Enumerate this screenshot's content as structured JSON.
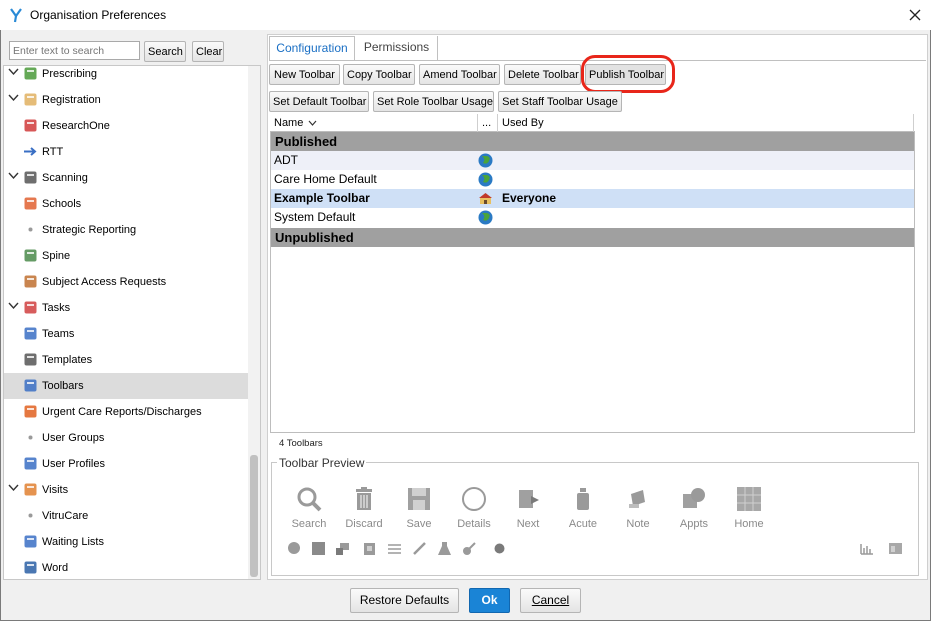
{
  "window": {
    "title": "Organisation Preferences"
  },
  "search": {
    "placeholder": "Enter text to search",
    "search_label": "Search",
    "clear_label": "Clear"
  },
  "tree": {
    "items": [
      {
        "label": "Prescribing",
        "chevron": true,
        "icon": "prescribing-icon",
        "color": "#4a9a3a"
      },
      {
        "label": "Registration",
        "chevron": true,
        "icon": "registration-folder-icon",
        "color": "#e0b060"
      },
      {
        "label": "ResearchOne",
        "chevron": false,
        "icon": "research-cube-icon",
        "color": "#d03a3a"
      },
      {
        "label": "RTT",
        "chevron": false,
        "icon": "arrow-right-icon",
        "color": "#3a6fc4"
      },
      {
        "label": "Scanning",
        "chevron": true,
        "icon": "scanner-icon",
        "color": "#555555"
      },
      {
        "label": "Schools",
        "chevron": false,
        "icon": "school-icon",
        "color": "#e06030"
      },
      {
        "label": "Strategic Reporting",
        "chevron": false,
        "icon": "dot-icon",
        "color": "#9a9a9a"
      },
      {
        "label": "Spine",
        "chevron": false,
        "icon": "spine-icon",
        "color": "#4a8a4a"
      },
      {
        "label": "Subject Access Requests",
        "chevron": false,
        "icon": "document-icon",
        "color": "#c07030"
      },
      {
        "label": "Tasks",
        "chevron": true,
        "icon": "tasks-clipboard-icon",
        "color": "#d04040"
      },
      {
        "label": "Teams",
        "chevron": false,
        "icon": "teams-people-icon",
        "color": "#3a6fc4"
      },
      {
        "label": "Templates",
        "chevron": false,
        "icon": "templates-icon",
        "color": "#555555"
      },
      {
        "label": "Toolbars",
        "chevron": false,
        "icon": "toolbars-icon",
        "color": "#3a6fc4"
      },
      {
        "label": "Urgent Care Reports/Discharges",
        "chevron": false,
        "icon": "urgent-care-icon",
        "color": "#e06020"
      },
      {
        "label": "User Groups",
        "chevron": false,
        "icon": "dot-icon",
        "color": "#9a9a9a"
      },
      {
        "label": "User Profiles",
        "chevron": false,
        "icon": "user-profile-icon",
        "color": "#3a6fc4"
      },
      {
        "label": "Visits",
        "chevron": true,
        "icon": "visits-house-icon",
        "color": "#e08030"
      },
      {
        "label": "VitruCare",
        "chevron": false,
        "icon": "dot-icon",
        "color": "#9a9a9a"
      },
      {
        "label": "Waiting Lists",
        "chevron": false,
        "icon": "waiting-list-icon",
        "color": "#3a6fc4"
      },
      {
        "label": "Word",
        "chevron": false,
        "icon": "word-doc-icon",
        "color": "#2a5fa4"
      }
    ],
    "selected": "Toolbars"
  },
  "tabs": [
    {
      "label": "Configuration",
      "active": true
    },
    {
      "label": "Permissions",
      "active": false
    }
  ],
  "toolbar": {
    "row1": [
      "New Toolbar",
      "Copy Toolbar",
      "Amend Toolbar",
      "Delete Toolbar",
      "Publish Toolbar"
    ],
    "row2": [
      "Set Default Toolbar",
      "Set Role Toolbar Usage",
      "Set Staff Toolbar Usage"
    ]
  },
  "grid": {
    "columns": [
      "Name",
      "...",
      "Used By"
    ],
    "groups": {
      "published": "Published",
      "unpublished": "Unpublished"
    },
    "rows": [
      {
        "name": "ADT",
        "icon": "globe-icon",
        "used_by": ""
      },
      {
        "name": "Care Home Default",
        "icon": "globe-icon",
        "used_by": ""
      },
      {
        "name": "Example Toolbar",
        "icon": "organisation-icon",
        "used_by": "Everyone"
      },
      {
        "name": "System Default",
        "icon": "globe-icon",
        "used_by": ""
      }
    ],
    "count": "4 Toolbars"
  },
  "preview": {
    "label": "Toolbar Preview",
    "items": [
      "Search",
      "Discard",
      "Save",
      "Details",
      "Next",
      "Acute",
      "Note",
      "Appts",
      "Home"
    ]
  },
  "footer": {
    "restore_label": "Restore Defaults",
    "ok_label": "Ok",
    "cancel_label": "Cancel"
  },
  "colors": {
    "accent": "#1a84d6",
    "highlight": "#e8261a",
    "selected_row": "#cfe0f6",
    "group_header": "#a0a0a0"
  }
}
